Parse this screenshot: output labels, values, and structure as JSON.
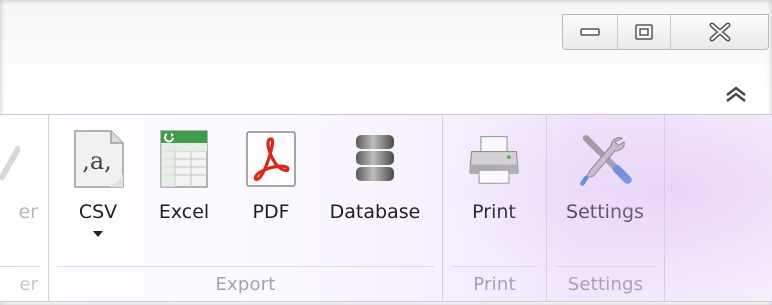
{
  "window": {
    "controls": {
      "minimize": "minimize-icon",
      "restore": "restore-icon",
      "close": "close-icon"
    }
  },
  "ribbon": {
    "collapse_icon": "chevron-up-icon",
    "partial_group": {
      "button_label_fragment": "er",
      "group_label_fragment": "er"
    },
    "export": {
      "label": "Export",
      "buttons": [
        {
          "label": "CSV",
          "icon": "csv-file-icon",
          "has_dropdown": true
        },
        {
          "label": "Excel",
          "icon": "excel-file-icon"
        },
        {
          "label": "PDF",
          "icon": "pdf-file-icon"
        },
        {
          "label": "Database",
          "icon": "database-icon"
        }
      ]
    },
    "print": {
      "label": "Print",
      "button_label": "Print",
      "icon": "printer-icon"
    },
    "settings": {
      "label": "Settings",
      "button_label": "Settings",
      "icon": "tools-icon"
    }
  },
  "colors": {
    "ribbon_accent": "#e9d9f7",
    "pdf_red": "#d9271c",
    "excel_green": "#2e8b3a",
    "settings_blue": "#2b6fd6"
  }
}
